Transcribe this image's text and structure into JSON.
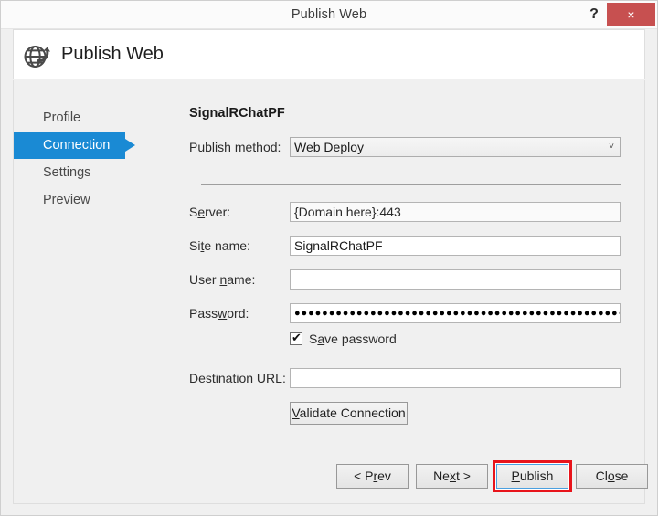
{
  "window": {
    "title": "Publish Web",
    "help_label": "?",
    "close_label": "×"
  },
  "header": {
    "icon": "globe-publish-icon",
    "title": "Publish Web"
  },
  "sidebar": {
    "items": [
      {
        "label": "Profile",
        "selected": false
      },
      {
        "label": "Connection",
        "selected": true
      },
      {
        "label": "Settings",
        "selected": false
      },
      {
        "label": "Preview",
        "selected": false
      }
    ]
  },
  "main": {
    "project_name": "SignalRChatPF",
    "publish_method": {
      "label_before": "Publish ",
      "label_accel": "m",
      "label_after": "ethod:",
      "value": "Web Deploy",
      "chevron": "˅",
      "options": [
        "Web Deploy"
      ]
    },
    "fields": [
      {
        "name": "server",
        "label_before": "S",
        "label_accel": "e",
        "label_after": "rver:",
        "value": "{Domain here}:443",
        "placeholder": ""
      },
      {
        "name": "site-name",
        "label_before": "Si",
        "label_accel": "t",
        "label_after": "e name:",
        "value": "SignalRChatPF",
        "placeholder": ""
      },
      {
        "name": "user-name",
        "label_before": "User ",
        "label_accel": "n",
        "label_after": "ame:",
        "value": "",
        "placeholder": ""
      },
      {
        "name": "password",
        "label_before": "Pass",
        "label_accel": "w",
        "label_after": "ord:",
        "value": "●●●●●●●●●●●●●●●●●●●●●●●●●●●●●●●●●●●●●●●●●●●●●●●●●",
        "placeholder": ""
      },
      {
        "name": "destination-url",
        "label_before": "Destination UR",
        "label_accel": "L",
        "label_after": ":",
        "value": "",
        "placeholder": ""
      }
    ],
    "save_password": {
      "checked": true,
      "check_glyph": "✔",
      "label_before": "S",
      "label_accel": "a",
      "label_after": "ve password"
    },
    "validate_button": {
      "label_before": "",
      "label_accel": "V",
      "label_after": "alidate Connection"
    }
  },
  "footer": {
    "buttons": [
      {
        "name": "prev",
        "before": "< P",
        "accel": "r",
        "after": "ev"
      },
      {
        "name": "next",
        "before": "Ne",
        "accel": "x",
        "after": "t >"
      },
      {
        "name": "publish",
        "before": "",
        "accel": "P",
        "after": "ublish"
      },
      {
        "name": "close",
        "before": "Cl",
        "accel": "o",
        "after": "se"
      }
    ],
    "focused_button": "publish",
    "highlight_color": "#e8141b"
  },
  "colors": {
    "accent_blue": "#1a8ad4",
    "close_red": "#c75050",
    "dialog_bg": "#f0f0f0",
    "annotation_red": "#e8141b"
  }
}
